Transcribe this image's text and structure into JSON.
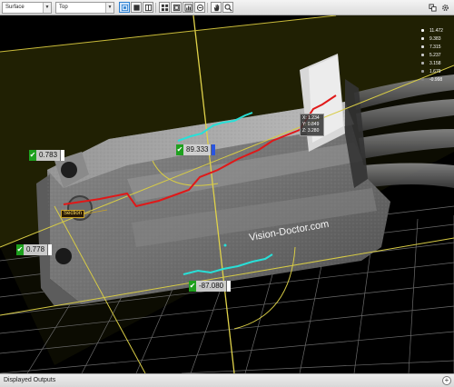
{
  "toolbar": {
    "view_mode": {
      "selected": "Surface"
    },
    "camera_view": {
      "selected": "Top"
    }
  },
  "viewport": {
    "watermark": "Vision-Doctor.com",
    "section_label": "Section",
    "measurements": [
      {
        "value": "0.783",
        "indicator": "#ffffff"
      },
      {
        "value": "89.333",
        "indicator": "#2a55e0"
      },
      {
        "value": "0.778",
        "indicator": "#ffffff"
      },
      {
        "value": "-87.080",
        "indicator": "#ffffff"
      }
    ],
    "coordinates": {
      "x": "X: 1.234",
      "y": "Y: 0.849",
      "z": "Z: 3.280"
    },
    "height_legend": [
      {
        "value": "11.472",
        "color": "#ffffff"
      },
      {
        "value": "9.383",
        "color": "#eeeeee"
      },
      {
        "value": "7.315",
        "color": "#dddddd"
      },
      {
        "value": "5.237",
        "color": "#c8c8c8"
      },
      {
        "value": "3.158",
        "color": "#b0b0b0"
      },
      {
        "value": "1.679",
        "color": "#9a9a9a"
      },
      {
        "value": "-0.998",
        "color": "#7f7f7f"
      }
    ]
  },
  "bottom_panel": {
    "title": "Displayed Outputs",
    "expand_symbol": "+"
  }
}
